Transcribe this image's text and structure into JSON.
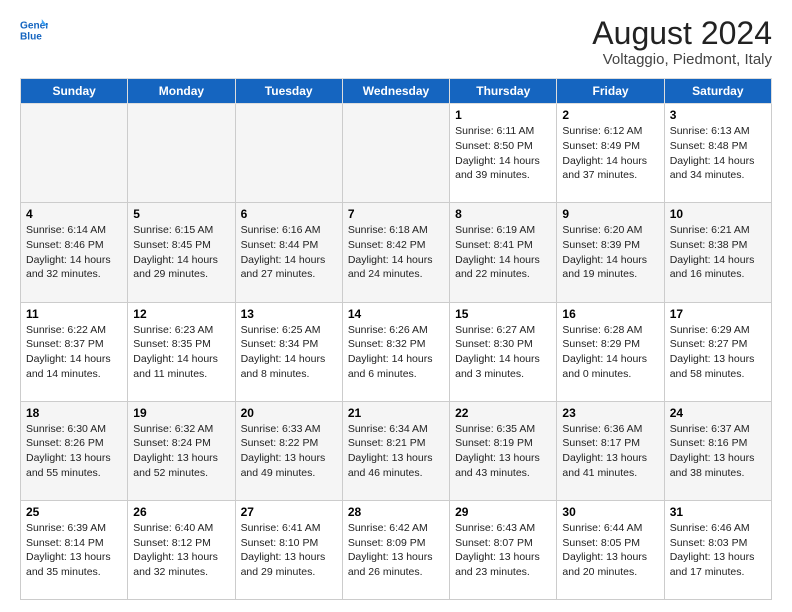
{
  "logo": {
    "line1": "General",
    "line2": "Blue"
  },
  "title": "August 2024",
  "subtitle": "Voltaggio, Piedmont, Italy",
  "days_of_week": [
    "Sunday",
    "Monday",
    "Tuesday",
    "Wednesday",
    "Thursday",
    "Friday",
    "Saturday"
  ],
  "weeks": [
    [
      {
        "day": "",
        "info": ""
      },
      {
        "day": "",
        "info": ""
      },
      {
        "day": "",
        "info": ""
      },
      {
        "day": "",
        "info": ""
      },
      {
        "day": "1",
        "info": "Sunrise: 6:11 AM\nSunset: 8:50 PM\nDaylight: 14 hours\nand 39 minutes."
      },
      {
        "day": "2",
        "info": "Sunrise: 6:12 AM\nSunset: 8:49 PM\nDaylight: 14 hours\nand 37 minutes."
      },
      {
        "day": "3",
        "info": "Sunrise: 6:13 AM\nSunset: 8:48 PM\nDaylight: 14 hours\nand 34 minutes."
      }
    ],
    [
      {
        "day": "4",
        "info": "Sunrise: 6:14 AM\nSunset: 8:46 PM\nDaylight: 14 hours\nand 32 minutes."
      },
      {
        "day": "5",
        "info": "Sunrise: 6:15 AM\nSunset: 8:45 PM\nDaylight: 14 hours\nand 29 minutes."
      },
      {
        "day": "6",
        "info": "Sunrise: 6:16 AM\nSunset: 8:44 PM\nDaylight: 14 hours\nand 27 minutes."
      },
      {
        "day": "7",
        "info": "Sunrise: 6:18 AM\nSunset: 8:42 PM\nDaylight: 14 hours\nand 24 minutes."
      },
      {
        "day": "8",
        "info": "Sunrise: 6:19 AM\nSunset: 8:41 PM\nDaylight: 14 hours\nand 22 minutes."
      },
      {
        "day": "9",
        "info": "Sunrise: 6:20 AM\nSunset: 8:39 PM\nDaylight: 14 hours\nand 19 minutes."
      },
      {
        "day": "10",
        "info": "Sunrise: 6:21 AM\nSunset: 8:38 PM\nDaylight: 14 hours\nand 16 minutes."
      }
    ],
    [
      {
        "day": "11",
        "info": "Sunrise: 6:22 AM\nSunset: 8:37 PM\nDaylight: 14 hours\nand 14 minutes."
      },
      {
        "day": "12",
        "info": "Sunrise: 6:23 AM\nSunset: 8:35 PM\nDaylight: 14 hours\nand 11 minutes."
      },
      {
        "day": "13",
        "info": "Sunrise: 6:25 AM\nSunset: 8:34 PM\nDaylight: 14 hours\nand 8 minutes."
      },
      {
        "day": "14",
        "info": "Sunrise: 6:26 AM\nSunset: 8:32 PM\nDaylight: 14 hours\nand 6 minutes."
      },
      {
        "day": "15",
        "info": "Sunrise: 6:27 AM\nSunset: 8:30 PM\nDaylight: 14 hours\nand 3 minutes."
      },
      {
        "day": "16",
        "info": "Sunrise: 6:28 AM\nSunset: 8:29 PM\nDaylight: 14 hours\nand 0 minutes."
      },
      {
        "day": "17",
        "info": "Sunrise: 6:29 AM\nSunset: 8:27 PM\nDaylight: 13 hours\nand 58 minutes."
      }
    ],
    [
      {
        "day": "18",
        "info": "Sunrise: 6:30 AM\nSunset: 8:26 PM\nDaylight: 13 hours\nand 55 minutes."
      },
      {
        "day": "19",
        "info": "Sunrise: 6:32 AM\nSunset: 8:24 PM\nDaylight: 13 hours\nand 52 minutes."
      },
      {
        "day": "20",
        "info": "Sunrise: 6:33 AM\nSunset: 8:22 PM\nDaylight: 13 hours\nand 49 minutes."
      },
      {
        "day": "21",
        "info": "Sunrise: 6:34 AM\nSunset: 8:21 PM\nDaylight: 13 hours\nand 46 minutes."
      },
      {
        "day": "22",
        "info": "Sunrise: 6:35 AM\nSunset: 8:19 PM\nDaylight: 13 hours\nand 43 minutes."
      },
      {
        "day": "23",
        "info": "Sunrise: 6:36 AM\nSunset: 8:17 PM\nDaylight: 13 hours\nand 41 minutes."
      },
      {
        "day": "24",
        "info": "Sunrise: 6:37 AM\nSunset: 8:16 PM\nDaylight: 13 hours\nand 38 minutes."
      }
    ],
    [
      {
        "day": "25",
        "info": "Sunrise: 6:39 AM\nSunset: 8:14 PM\nDaylight: 13 hours\nand 35 minutes."
      },
      {
        "day": "26",
        "info": "Sunrise: 6:40 AM\nSunset: 8:12 PM\nDaylight: 13 hours\nand 32 minutes."
      },
      {
        "day": "27",
        "info": "Sunrise: 6:41 AM\nSunset: 8:10 PM\nDaylight: 13 hours\nand 29 minutes."
      },
      {
        "day": "28",
        "info": "Sunrise: 6:42 AM\nSunset: 8:09 PM\nDaylight: 13 hours\nand 26 minutes."
      },
      {
        "day": "29",
        "info": "Sunrise: 6:43 AM\nSunset: 8:07 PM\nDaylight: 13 hours\nand 23 minutes."
      },
      {
        "day": "30",
        "info": "Sunrise: 6:44 AM\nSunset: 8:05 PM\nDaylight: 13 hours\nand 20 minutes."
      },
      {
        "day": "31",
        "info": "Sunrise: 6:46 AM\nSunset: 8:03 PM\nDaylight: 13 hours\nand 17 minutes."
      }
    ]
  ]
}
